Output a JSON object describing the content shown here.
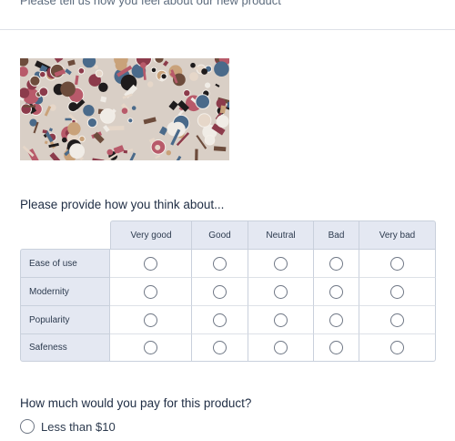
{
  "header": {
    "description": "Please tell us how you feel about our new product"
  },
  "image": {
    "icon": "cosmetics-photo",
    "colors": [
      "#1e1b1c",
      "#c9a27a",
      "#8c3b4b",
      "#e6d7c9",
      "#4a6a8a",
      "#b85a6a",
      "#f0ece6",
      "#6d4c3c"
    ]
  },
  "matrix_question": {
    "title": "Please provide how you think about...",
    "columns": [
      "Very good",
      "Good",
      "Neutral",
      "Bad",
      "Very bad"
    ],
    "rows": [
      "Ease of use",
      "Modernity",
      "Popularity",
      "Safeness"
    ]
  },
  "price_question": {
    "title": "How much would you pay for this product?",
    "options": [
      "Less than $10"
    ]
  }
}
